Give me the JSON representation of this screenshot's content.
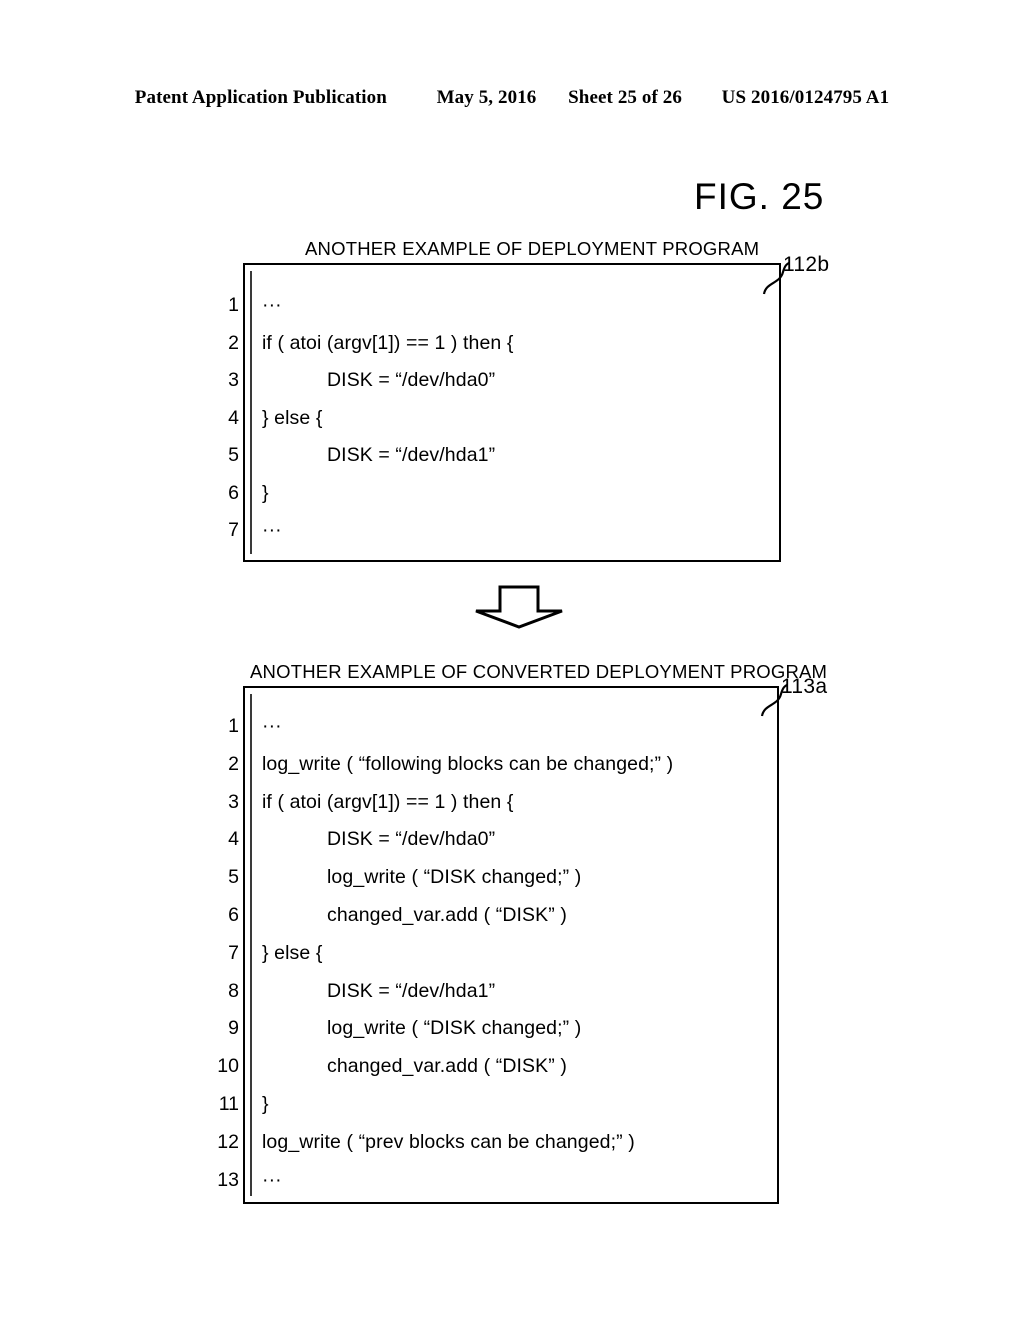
{
  "header": {
    "publication": "Patent Application Publication",
    "date": "May 5, 2016",
    "sheet": "Sheet 25 of 26",
    "patent_number": "US 2016/0124795 A1"
  },
  "figure": {
    "title": "FIG. 25"
  },
  "blocks": [
    {
      "caption": "ANOTHER EXAMPLE OF DEPLOYMENT PROGRAM",
      "ref_label": "112b",
      "lines": [
        {
          "no": "1",
          "text": "···",
          "indent": 0
        },
        {
          "no": "2",
          "text": "if ( atoi (argv[1]) == 1 ) then {",
          "indent": 0
        },
        {
          "no": "3",
          "text": "DISK = “/dev/hda0”",
          "indent": 1
        },
        {
          "no": "4",
          "text": "} else {",
          "indent": 0
        },
        {
          "no": "5",
          "text": "DISK = “/dev/hda1”",
          "indent": 1
        },
        {
          "no": "6",
          "text": "}",
          "indent": 0
        },
        {
          "no": "7",
          "text": "···",
          "indent": 0
        }
      ]
    },
    {
      "caption": "ANOTHER EXAMPLE OF CONVERTED DEPLOYMENT PROGRAM",
      "ref_label": "113a",
      "lines": [
        {
          "no": "1",
          "text": "···",
          "indent": 0
        },
        {
          "no": "2",
          "text": "log_write ( “following blocks can be changed;” )",
          "indent": 0
        },
        {
          "no": "3",
          "text": "if ( atoi (argv[1]) == 1 ) then {",
          "indent": 0
        },
        {
          "no": "4",
          "text": "DISK = “/dev/hda0”",
          "indent": 1
        },
        {
          "no": "5",
          "text": "log_write ( “DISK changed;” )",
          "indent": 1
        },
        {
          "no": "6",
          "text": "changed_var.add ( “DISK” )",
          "indent": 1
        },
        {
          "no": "7",
          "text": "} else {",
          "indent": 0
        },
        {
          "no": "8",
          "text": "DISK = “/dev/hda1”",
          "indent": 1
        },
        {
          "no": "9",
          "text": "log_write ( “DISK changed;” )",
          "indent": 1
        },
        {
          "no": "10",
          "text": "changed_var.add ( “DISK” )",
          "indent": 1
        },
        {
          "no": "11",
          "text": "}",
          "indent": 0
        },
        {
          "no": "12",
          "text": "log_write ( “prev blocks can be changed;” )",
          "indent": 0
        },
        {
          "no": "13",
          "text": "···",
          "indent": 0
        }
      ]
    }
  ],
  "arrow": {
    "name": "down-arrow",
    "direction": "down"
  },
  "colors": {
    "ink": "#000000",
    "paper": "#ffffff"
  }
}
